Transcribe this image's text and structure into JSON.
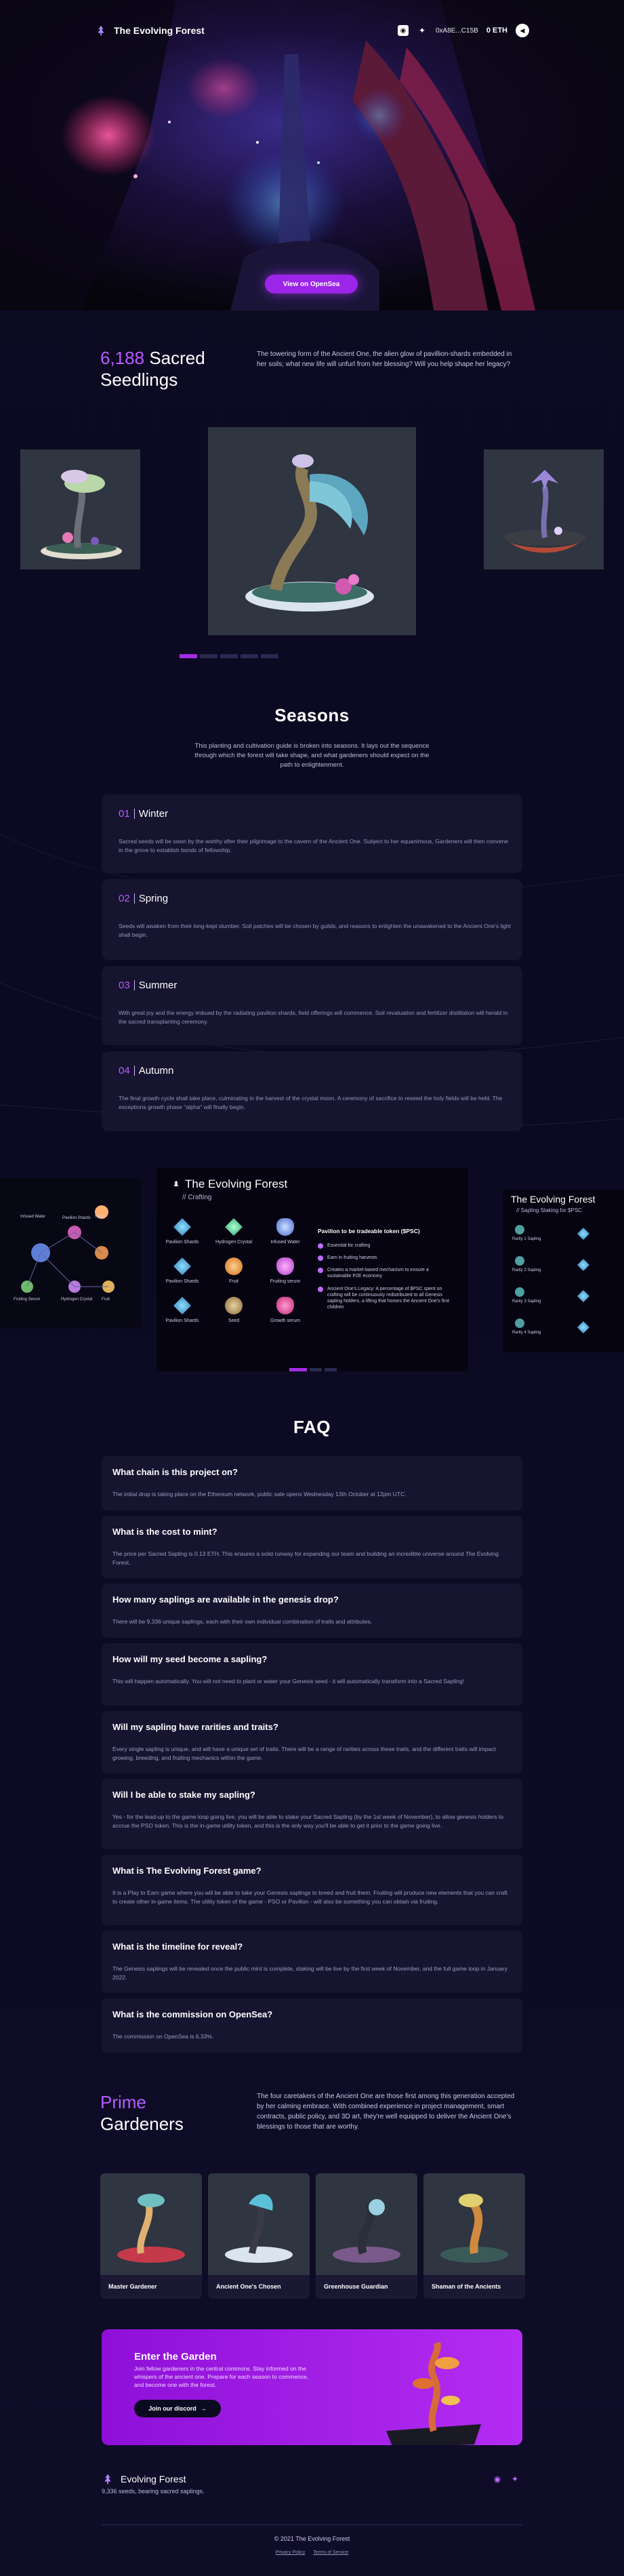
{
  "header": {
    "brand": "The Evolving Forest",
    "wallet": "0xA8E...C15B",
    "eth_balance": "0 ETH"
  },
  "hero": {
    "cta_label": "View on OpenSea"
  },
  "seedlings": {
    "count": "6,188",
    "title_rest": "Sacred",
    "title_line2": "Seedlings",
    "text": "The towering form of the Ancient One, the alien glow of pavillion-shards embedded in her soils; what new life will unfurl from her blessing? Will you help shape her legacy?"
  },
  "seasons": {
    "title": "Seasons",
    "subtitle": "This planting and cultivation guide is broken into seasons. It lays out the sequence through which the forest will take shape, and what gardeners should expect on the path to enlightenment.",
    "items": [
      {
        "num": "01",
        "name": "Winter",
        "text": "Sacred seeds will be sown by the worthy after their pilgrimage to the cavern of the Ancient One. Subject to her equanimous, Gardeners will then convene in the grove to establish bonds of fellowship."
      },
      {
        "num": "02",
        "name": "Spring",
        "text": "Seeds will awaken from their long-kept slumber. Soil patches will be chosen by guilds, and reasons to enlighten the unawakened to the Ancient One's light shall begin."
      },
      {
        "num": "03",
        "name": "Summer",
        "text": "With great joy and the energy imbued by the radiating pavilion shards, field offerings will commence. Soil revaluation and fertilizer distillation will herald in the sacred transplanting ceremony."
      },
      {
        "num": "04",
        "name": "Autumn",
        "text": "The final growth cycle shall take place, culminating in the harvest of the crystal moon. A ceremony of sacrifice to reseed the holy fields will be held. The exceptions growth phase \"alpha\" will finally begin."
      }
    ]
  },
  "crafting": {
    "title": "The Evolving Forest",
    "subtitle": "// Crafting",
    "ingredients": [
      "Pavilion Shards",
      "Hydrogen Crystal",
      "Infused Water",
      "Pavilion Shards",
      "Fruit",
      "Fruiting serum",
      "Pavilion Shards",
      "Seed",
      "Growth serum"
    ],
    "rules_title": "Pavilion to be tradeable token ($PSC)",
    "rules": [
      "Essential for crafting",
      "Earn in fruiting harvests",
      "Creates a market-based mechanism to ensure a sustainable P2E economy",
      "Ancient One's Legacy: A percentage of $PSC spent on crafting will be continuously redistributed to all Genesis sapling holders, a lifting that honors the Ancient One's first children"
    ],
    "right_title": "The Evolving Forest",
    "right_subtitle": "// Sapling Staking for $PSC",
    "right_rows": [
      "Rarity 1 Sapling",
      "Rarity 2 Sapling",
      "Rarity 3 Sapling",
      "Rarity 4 Sapling"
    ],
    "left_labels": [
      "Infused Water",
      "Pavilion Shards",
      "Seed",
      "Hydrogen Crystal",
      "Fruiting Serum",
      "Fruit"
    ]
  },
  "faq": {
    "title": "FAQ",
    "items": [
      {
        "q": "What chain is this project on?",
        "a": "The initial drop is taking place on the Ethereum network, public sale opens Wednesday 13th October at 12pm UTC."
      },
      {
        "q": "What is the cost to mint?",
        "a": "The price per Sacred Sapling is 0.13 ETH. This ensures a solid runway for expanding our team and building an incredible universe around The Evolving Forest."
      },
      {
        "q": "How many saplings are available in the genesis drop?",
        "a": "There will be 9,336 unique saplings, each with their own individual combination of traits and attributes."
      },
      {
        "q": "How will my seed become a sapling?",
        "a": "This will happen automatically. You will not need to plant or water your Genesis seed - it will automatically transform into a Sacred Sapling!"
      },
      {
        "q": "Will my sapling have rarities and traits?",
        "a": "Every single sapling is unique, and will have a unique set of traits. There will be a range of rarities across these traits, and the different traits will impact growing, breeding, and fruiting mechanics within the game."
      },
      {
        "q": "Will I be able to stake my sapling?",
        "a": "Yes - for the lead-up to the game loop going live, you will be able to stake your Sacred Sapling (by the 1st week of November), to allow genesis holders to accrue the PSO token. This is the in-game utility token, and this is the only way you'll be able to get it prior to the game going live."
      },
      {
        "q": "What is The Evolving Forest game?",
        "a": "It is a Play to Earn game where you will be able to take your Genesis saplings to breed and fruit them. Fruiting will produce new elements that you can craft to create other in-game items. The utility token of the game - PSO or Pavilion - will also be something you can obtain via fruiting."
      },
      {
        "q": "What is the timeline for reveal?",
        "a": "The Genesis saplings will be revealed once the public mint is complete, staking will be live by the first week of November, and the full game loop in January 2022."
      },
      {
        "q": "What is the commission on OpenSea?",
        "a": "The commission on OpenSea is 6.33%."
      }
    ]
  },
  "gardeners": {
    "title_line1": "Prime",
    "title_line2": "Gardeners",
    "text": "The four caretakers of the Ancient One are those first among this generation accepted by her calming embrace. With combined experience in project management, smart contracts, public policy, and 3D art, they're well equipped to deliver the Ancient One's blessings to those that are worthy.",
    "members": [
      "Master Gardener",
      "Ancient One's Chosen",
      "Greenhouse Guardian",
      "Shaman of the Ancients"
    ]
  },
  "enter": {
    "title": "Enter the Garden",
    "text": "Join fellow gardeners in the central commons. Stay informed on the whispers of the ancient one. Prepare for each season to commence, and become one with the forest.",
    "button": "Join our discord"
  },
  "footer": {
    "brand": "Evolving Forest",
    "tagline": "9,336 seeds, bearing sacred saplings.",
    "copyright": "© 2021 The Evolving Forest",
    "links": [
      "Privacy Policy",
      "Terms of Service"
    ]
  },
  "colors": {
    "accent": "#b75cff",
    "button": "#9b25e8",
    "bg": "#0c0a20",
    "card": "#16142f"
  }
}
